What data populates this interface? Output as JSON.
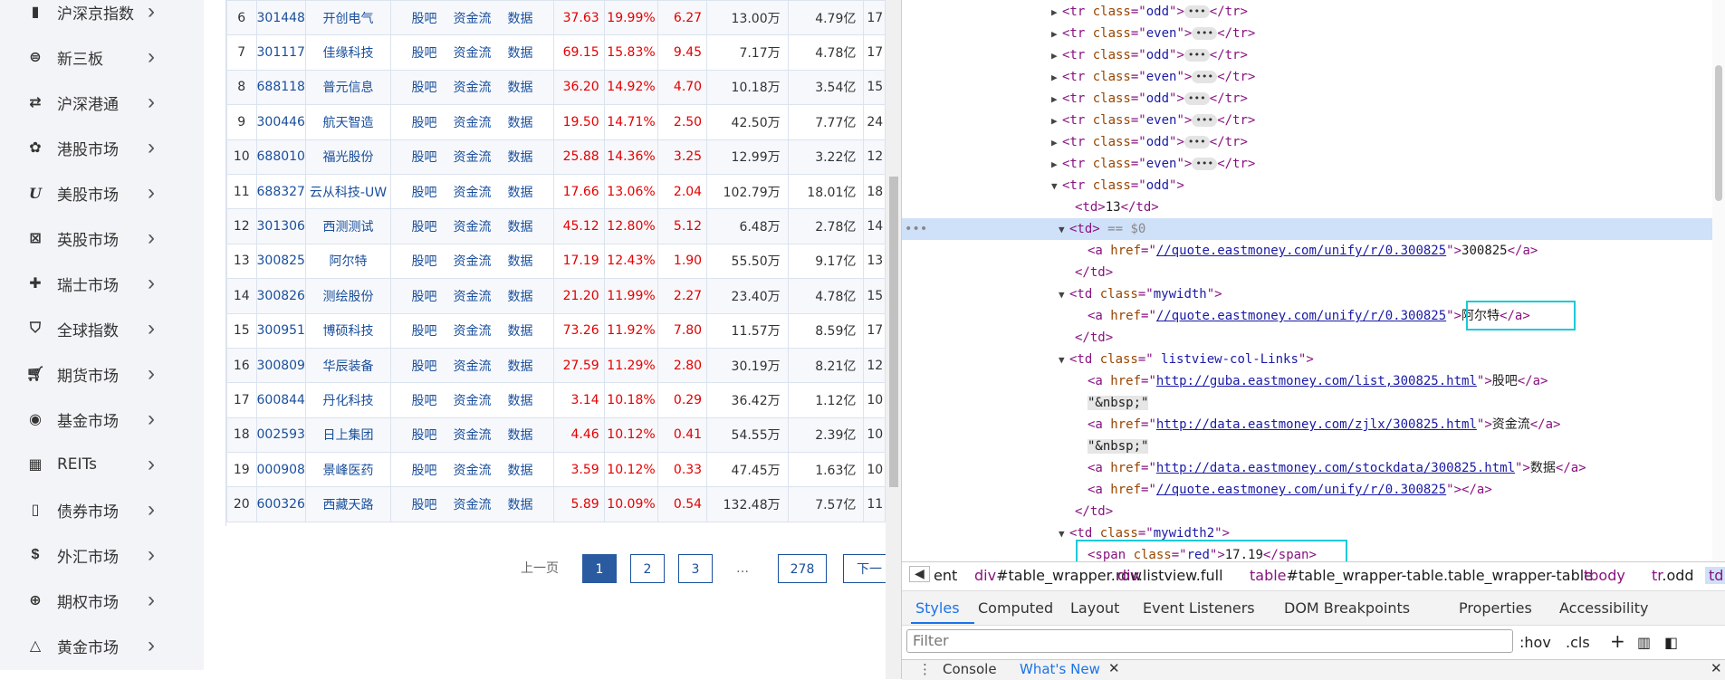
{
  "sidebar": {
    "items": [
      {
        "label": "沪深京指数",
        "icon": "bar-chart-icon"
      },
      {
        "label": "新三板",
        "icon": "list-circle-icon"
      },
      {
        "label": "沪深港通",
        "icon": "exchange-arrows-icon"
      },
      {
        "label": "港股市场",
        "icon": "bauhinia-icon"
      },
      {
        "label": "美股市场",
        "icon": "u-letter-icon"
      },
      {
        "label": "英股市场",
        "icon": "uk-flag-icon"
      },
      {
        "label": "瑞士市场",
        "icon": "swiss-cross-icon"
      },
      {
        "label": "全球指数",
        "icon": "bookmark-icon"
      },
      {
        "label": "期货市场",
        "icon": "cart-icon"
      },
      {
        "label": "基金市场",
        "icon": "fund-coin-icon"
      },
      {
        "label": "REITs",
        "icon": "building-icon"
      },
      {
        "label": "债券市场",
        "icon": "bond-document-icon"
      },
      {
        "label": "外汇市场",
        "icon": "currency-swap-icon"
      },
      {
        "label": "期权市场",
        "icon": "globe-icon"
      },
      {
        "label": "黄金市场",
        "icon": "gold-bars-icon"
      }
    ]
  },
  "table": {
    "link_labels": [
      "股吧",
      "资金流",
      "数据"
    ],
    "rows": [
      {
        "no": "6",
        "code": "301448",
        "name": "开创电气",
        "price": "37.63",
        "pct": "19.99%",
        "chg": "6.27",
        "vol": "13.00万",
        "amt": "4.79亿",
        "more": "17"
      },
      {
        "no": "7",
        "code": "301117",
        "name": "佳缘科技",
        "price": "69.15",
        "pct": "15.83%",
        "chg": "9.45",
        "vol": "7.17万",
        "amt": "4.78亿",
        "more": "17"
      },
      {
        "no": "8",
        "code": "688118",
        "name": "普元信息",
        "price": "36.20",
        "pct": "14.92%",
        "chg": "4.70",
        "vol": "10.18万",
        "amt": "3.54亿",
        "more": "15"
      },
      {
        "no": "9",
        "code": "300446",
        "name": "航天智造",
        "price": "19.50",
        "pct": "14.71%",
        "chg": "2.50",
        "vol": "42.50万",
        "amt": "7.77亿",
        "more": "24"
      },
      {
        "no": "10",
        "code": "688010",
        "name": "福光股份",
        "price": "25.88",
        "pct": "14.36%",
        "chg": "3.25",
        "vol": "12.99万",
        "amt": "3.22亿",
        "more": "12"
      },
      {
        "no": "11",
        "code": "688327",
        "name": "云从科技-UW",
        "price": "17.66",
        "pct": "13.06%",
        "chg": "2.04",
        "vol": "102.79万",
        "amt": "18.01亿",
        "more": "18"
      },
      {
        "no": "12",
        "code": "301306",
        "name": "西测测试",
        "price": "45.12",
        "pct": "12.80%",
        "chg": "5.12",
        "vol": "6.48万",
        "amt": "2.78亿",
        "more": "14"
      },
      {
        "no": "13",
        "code": "300825",
        "name": "阿尔特",
        "price": "17.19",
        "pct": "12.43%",
        "chg": "1.90",
        "vol": "55.50万",
        "amt": "9.17亿",
        "more": "13"
      },
      {
        "no": "14",
        "code": "300826",
        "name": "测绘股份",
        "price": "21.20",
        "pct": "11.99%",
        "chg": "2.27",
        "vol": "23.40万",
        "amt": "4.78亿",
        "more": "15"
      },
      {
        "no": "15",
        "code": "300951",
        "name": "博硕科技",
        "price": "73.26",
        "pct": "11.92%",
        "chg": "7.80",
        "vol": "11.57万",
        "amt": "8.59亿",
        "more": "17"
      },
      {
        "no": "16",
        "code": "300809",
        "name": "华辰装备",
        "price": "27.59",
        "pct": "11.29%",
        "chg": "2.80",
        "vol": "30.19万",
        "amt": "8.21亿",
        "more": "12"
      },
      {
        "no": "17",
        "code": "600844",
        "name": "丹化科技",
        "price": "3.14",
        "pct": "10.18%",
        "chg": "0.29",
        "vol": "36.42万",
        "amt": "1.12亿",
        "more": "10"
      },
      {
        "no": "18",
        "code": "002593",
        "name": "日上集团",
        "price": "4.46",
        "pct": "10.12%",
        "chg": "0.41",
        "vol": "54.55万",
        "amt": "2.39亿",
        "more": "10"
      },
      {
        "no": "19",
        "code": "000908",
        "name": "景峰医药",
        "price": "3.59",
        "pct": "10.12%",
        "chg": "0.33",
        "vol": "47.45万",
        "amt": "1.63亿",
        "more": "10"
      },
      {
        "no": "20",
        "code": "600326",
        "name": "西藏天路",
        "price": "5.89",
        "pct": "10.09%",
        "chg": "0.54",
        "vol": "132.48万",
        "amt": "7.57亿",
        "more": "11"
      }
    ]
  },
  "pager": {
    "prev": "上一页",
    "pages": [
      "1",
      "2",
      "3"
    ],
    "ellipsis": "…",
    "last": "278",
    "next": "下一"
  },
  "devtools": {
    "collapsed_rows": [
      "odd",
      "even",
      "odd",
      "even",
      "odd",
      "even",
      "odd",
      "even"
    ],
    "expanded_row_class": "odd",
    "td_index": "13",
    "selected_marker": "== $0",
    "quote_url": "//quote.eastmoney.com/unify/r/0.300825",
    "code_text": "300825",
    "mywidth_class": "mywidth",
    "name_text": "阿尔特",
    "links_class": " listview-col-Links",
    "guba_url": "http://guba.eastmoney.com/list,300825.html",
    "guba_text": "股吧",
    "nbsp": "\"&nbsp;\"",
    "zjlx_url": "http://data.eastmoney.com/zjlx/300825.html",
    "zjlx_text": "资金流",
    "stockdata_url": "http://data.eastmoney.com/stockdata/300825.html",
    "stockdata_text": "数据",
    "mywidth2_class": "mywidth2",
    "span_class": "red",
    "span_text": "17.19",
    "breadcrumbs": [
      {
        "tag": "",
        "rest": "ent"
      },
      {
        "tag": "div",
        "rest": "#table_wrapper.row"
      },
      {
        "tag": "div",
        "rest": ".listview.full"
      },
      {
        "tag": "table",
        "rest": "#table_wrapper-table.table_wrapper-table"
      },
      {
        "tag": "tbody",
        "rest": ""
      },
      {
        "tag": "tr",
        "rest": ".odd"
      },
      {
        "tag": "td",
        "rest": ""
      }
    ],
    "tabs": [
      "Styles",
      "Computed",
      "Layout",
      "Event Listeners",
      "DOM Breakpoints",
      "Properties",
      "Accessibility"
    ],
    "filter_placeholder": "Filter",
    "hov": ":hov",
    "cls": ".cls",
    "drawer_tabs": [
      "Console",
      "What's New"
    ]
  }
}
